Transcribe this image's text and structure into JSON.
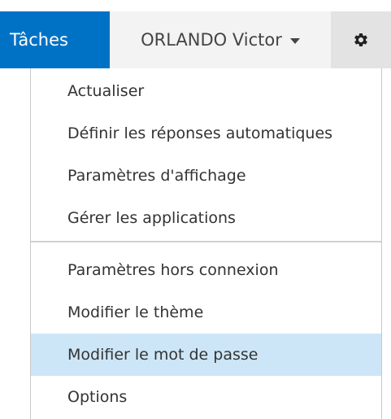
{
  "header": {
    "tab_label": "Tâches",
    "user_name": "ORLANDO Victor",
    "settings_icon": "gear-icon",
    "accent_color": "#0072c6"
  },
  "menu": {
    "group1": [
      {
        "label": "Actualiser"
      },
      {
        "label": "Définir les réponses automatiques"
      },
      {
        "label": "Paramètres d'affichage"
      },
      {
        "label": "Gérer les applications"
      }
    ],
    "group2": [
      {
        "label": "Paramètres hors connexion"
      },
      {
        "label": "Modifier le thème"
      },
      {
        "label": "Modifier le mot de passe",
        "selected": true
      },
      {
        "label": "Options"
      }
    ],
    "highlight_color": "#cde6f7"
  }
}
